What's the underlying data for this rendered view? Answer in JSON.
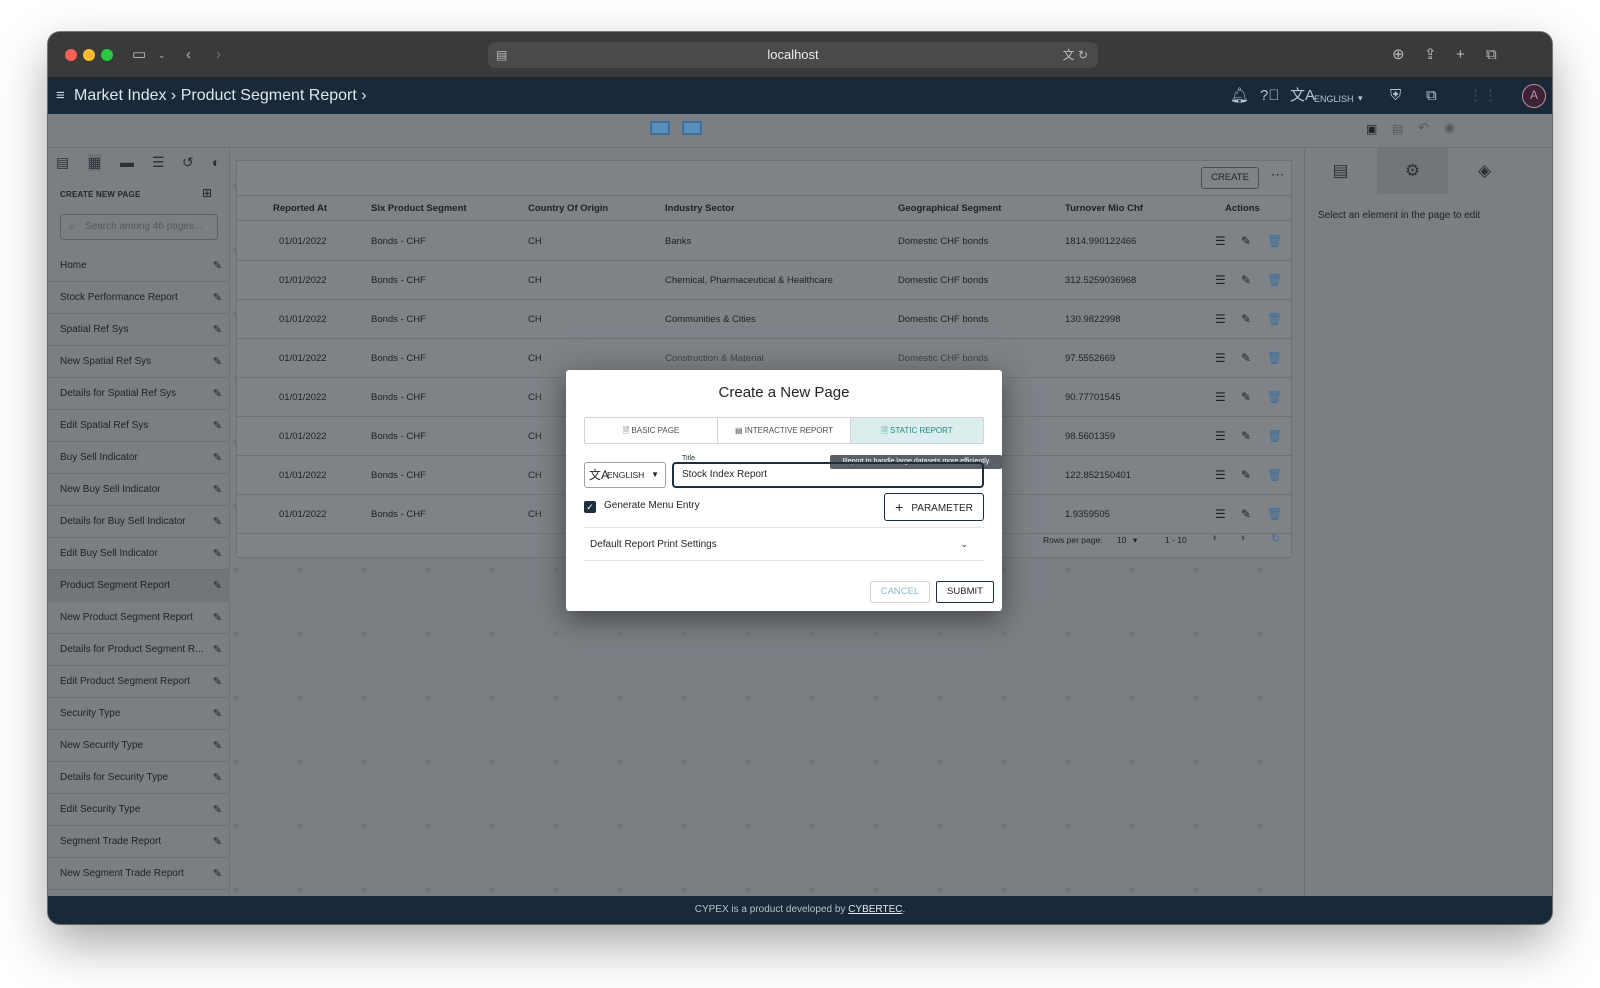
{
  "browser": {
    "url": "localhost"
  },
  "app": {
    "breadcrumb": "Market Index › Product Segment Report ›",
    "language": "ENGLISH",
    "avatar_letter": "A"
  },
  "left_panel": {
    "header": "CREATE NEW PAGE",
    "search_placeholder": "Search among 46 pages...",
    "items": [
      {
        "label": "Home"
      },
      {
        "label": "Stock Performance Report"
      },
      {
        "label": "Spatial Ref Sys"
      },
      {
        "label": "New Spatial Ref Sys"
      },
      {
        "label": "Details for Spatial Ref Sys"
      },
      {
        "label": "Edit Spatial Ref Sys"
      },
      {
        "label": "Buy Sell Indicator"
      },
      {
        "label": "New Buy Sell Indicator"
      },
      {
        "label": "Details for Buy Sell Indicator"
      },
      {
        "label": "Edit Buy Sell Indicator"
      },
      {
        "label": "Product Segment Report"
      },
      {
        "label": "New Product Segment Report"
      },
      {
        "label": "Details for Product Segment R..."
      },
      {
        "label": "Edit Product Segment Report"
      },
      {
        "label": "Security Type"
      },
      {
        "label": "New Security Type"
      },
      {
        "label": "Details for Security Type"
      },
      {
        "label": "Edit Security Type"
      },
      {
        "label": "Segment Trade Report"
      },
      {
        "label": "New Segment Trade Report"
      }
    ]
  },
  "table": {
    "create_label": "CREATE",
    "columns": [
      "Reported At",
      "Six Product Segment",
      "Country Of Origin",
      "Industry Sector",
      "Geographical Segment",
      "Turnover Mio Chf",
      "Actions"
    ],
    "rows": [
      [
        "01/01/2022",
        "Bonds - CHF",
        "CH",
        "Banks",
        "Domestic CHF bonds",
        "1814.990122466"
      ],
      [
        "01/01/2022",
        "Bonds - CHF",
        "CH",
        "Chemical, Pharmaceutical & Healthcare",
        "Domestic CHF bonds",
        "312.5259036968"
      ],
      [
        "01/01/2022",
        "Bonds - CHF",
        "CH",
        "Communities & Cities",
        "Domestic CHF bonds",
        "130.9822998"
      ],
      [
        "01/01/2022",
        "Bonds - CHF",
        "CH",
        "Construction & Material",
        "Domestic CHF bonds",
        "97.5552669"
      ],
      [
        "01/01/2022",
        "Bonds - CHF",
        "CH",
        "",
        "",
        "90.77701545"
      ],
      [
        "01/01/2022",
        "Bonds - CHF",
        "CH",
        "",
        "",
        "98.5601359"
      ],
      [
        "01/01/2022",
        "Bonds - CHF",
        "CH",
        "",
        "",
        "122.852150401"
      ],
      [
        "01/01/2022",
        "Bonds - CHF",
        "CH",
        "",
        "",
        "1.9359505"
      ]
    ],
    "rows_per_page_label": "Rows per page:",
    "rows_per_page": "10",
    "range": "1 - 10"
  },
  "right_panel": {
    "message": "Select an element in the page to edit"
  },
  "modal": {
    "title": "Create a New Page",
    "types": [
      "BASIC PAGE",
      "INTERACTIVE REPORT",
      "STATIC REPORT"
    ],
    "selected_type": "STATIC REPORT",
    "tooltip": "Report to handle large datasets more efficiently",
    "language": "ENGLISH",
    "title_label": "Title",
    "title_value": "Stock Index Report",
    "generate_menu_label": "Generate Menu Entry",
    "generate_menu_checked": true,
    "parameter_label": "PARAMETER",
    "print_settings_label": "Default Report Print Settings",
    "cancel_label": "CANCEL",
    "submit_label": "SUBMIT"
  },
  "footer": {
    "text": "CYPEX is a product developed by",
    "link": "CYBERTEC"
  },
  "colors": {
    "appbar": "#19293a",
    "accent": "#1f8a82",
    "overlay": "#7b7f84"
  }
}
